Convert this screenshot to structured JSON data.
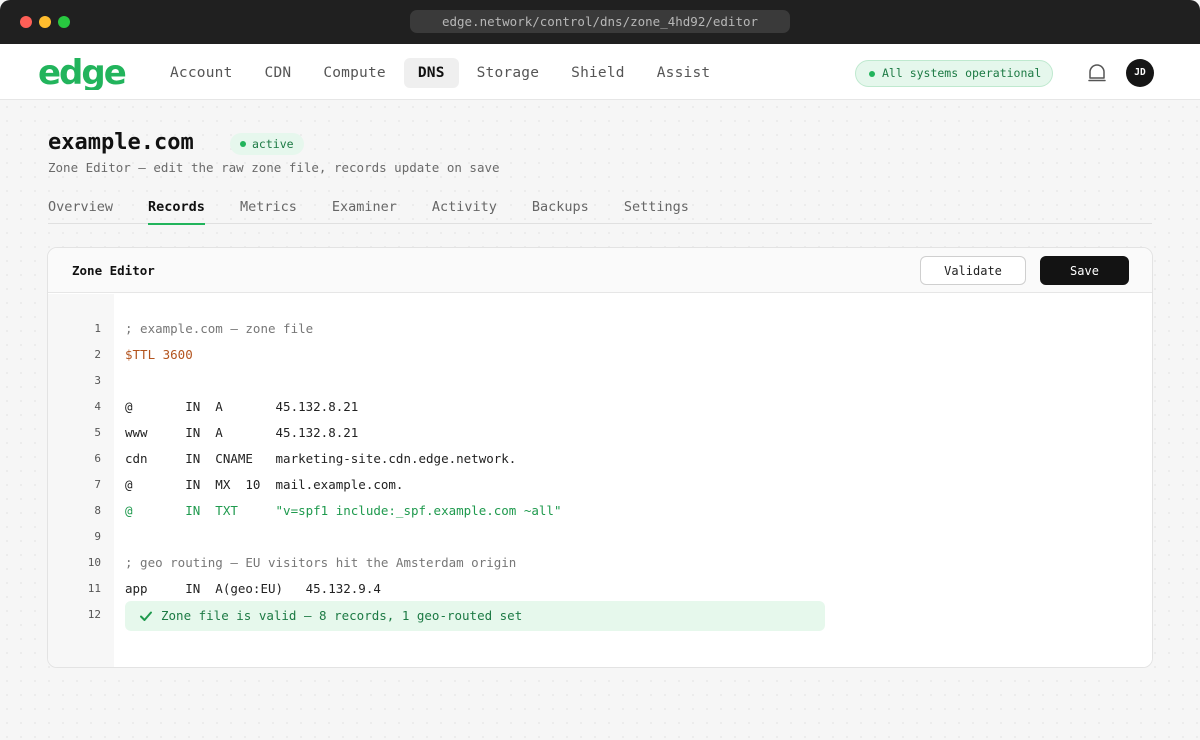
{
  "browser": {
    "url": "edge.network/control/dns/zone_4hd92/editor"
  },
  "header": {
    "logo_text": "edge",
    "nav": [
      "Account",
      "CDN",
      "Compute",
      "DNS",
      "Storage",
      "Shield",
      "Assist"
    ],
    "active_nav": "DNS",
    "status": "All systems operational",
    "avatar_initials": "JD",
    "icons": [
      "bell-icon"
    ]
  },
  "zone": {
    "name": "example.com",
    "badge": "active",
    "subtitle": "Zone Editor — edit the raw zone file, records update on save"
  },
  "tabs": [
    "Overview",
    "Records",
    "Metrics",
    "Examiner",
    "Activity",
    "Backups",
    "Settings"
  ],
  "active_tab": "Records",
  "editor": {
    "title": "Zone Editor",
    "validate_label": "Validate",
    "save_label": "Save",
    "lines": [
      {
        "n": "1",
        "text": "; example.com — zone file",
        "kind": "comment"
      },
      {
        "n": "2",
        "text": "$TTL 3600",
        "kind": "directive"
      },
      {
        "n": "3",
        "text": "",
        "kind": "plain"
      },
      {
        "n": "4",
        "text": "@       IN  A       45.132.8.21",
        "kind": "plain"
      },
      {
        "n": "5",
        "text": "www     IN  A       45.132.8.21",
        "kind": "plain"
      },
      {
        "n": "6",
        "text": "cdn     IN  CNAME   marketing-site.cdn.edge.network.",
        "kind": "plain"
      },
      {
        "n": "7",
        "text": "@       IN  MX  10  mail.example.com.",
        "kind": "plain"
      },
      {
        "n": "8",
        "text": "@       IN  TXT     \"v=spf1 include:_spf.example.com ~all\"",
        "kind": "txt"
      },
      {
        "n": "9",
        "text": "",
        "kind": "plain"
      },
      {
        "n": "10",
        "text": "; geo routing — EU visitors hit the Amsterdam origin",
        "kind": "comment"
      },
      {
        "n": "11",
        "text": "app     IN  A(geo:EU)   45.132.9.4",
        "kind": "plain"
      },
      {
        "n": "12",
        "text": "",
        "kind": "plain"
      }
    ],
    "validation_message": "Zone file is valid — 8 records, 1 geo-routed set"
  },
  "colors": {
    "accent": "#22b45c",
    "comment": "#777777",
    "directive": "#b3541e",
    "txt": "#1f9a4e"
  }
}
